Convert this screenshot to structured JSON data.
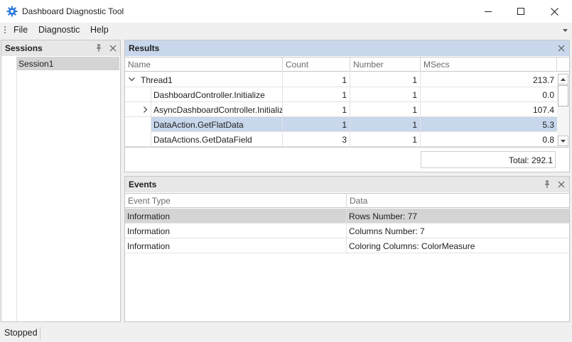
{
  "window": {
    "title": "Dashboard Diagnostic Tool"
  },
  "menu": {
    "items": [
      "File",
      "Diagnostic",
      "Help"
    ]
  },
  "sessions": {
    "title": "Sessions",
    "items": [
      "Session1"
    ]
  },
  "results": {
    "title": "Results",
    "columns": [
      "Name",
      "Count",
      "Number",
      "MSecs"
    ],
    "rows": [
      {
        "name": "Thread1",
        "count": "1",
        "number": "1",
        "msecs": "213.7",
        "expander": "expanded"
      },
      {
        "name": "DashboardController.Initialize",
        "count": "1",
        "number": "1",
        "msecs": "0.0",
        "expander": "none"
      },
      {
        "name": "AsyncDashboardController.Initialize",
        "count": "1",
        "number": "1",
        "msecs": "107.4",
        "expander": "collapsed"
      },
      {
        "name": "DataAction.GetFlatData",
        "count": "1",
        "number": "1",
        "msecs": "5.3",
        "expander": "none"
      },
      {
        "name": "DataActions.GetDataField",
        "count": "3",
        "number": "1",
        "msecs": "0.8",
        "expander": "none"
      }
    ],
    "total": "Total: 292.1"
  },
  "events": {
    "title": "Events",
    "columns": [
      "Event Type",
      "Data"
    ],
    "rows": [
      {
        "type": "Information",
        "data": "Rows Number: 77"
      },
      {
        "type": "Information",
        "data": "Columns Number: 7"
      },
      {
        "type": "Information",
        "data": "Coloring Columns: ColorMeasure"
      }
    ]
  },
  "status": {
    "text": "Stopped"
  },
  "colors": {
    "selection": "#c8d7ec",
    "grey_selection": "#d4d4d4",
    "icon_blue": "#2b79d8"
  }
}
